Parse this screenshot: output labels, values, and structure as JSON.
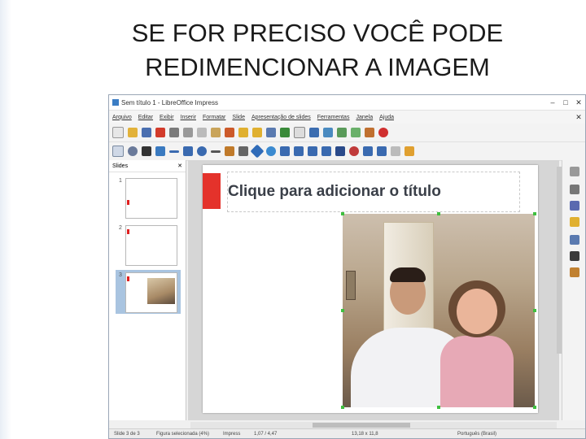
{
  "heading": {
    "line1": "SE FOR PRECISO VOCÊ PODE",
    "line2": "REDIMENCIONAR A IMAGEM"
  },
  "window": {
    "title": "Sem título 1 - LibreOffice Impress",
    "controls": {
      "minimize": "–",
      "maximize": "□",
      "close": "✕"
    }
  },
  "menu": {
    "items": [
      "Arquivo",
      "Editar",
      "Exibir",
      "Inserir",
      "Formatar",
      "Slide",
      "Apresentação de slides",
      "Ferramentas",
      "Janela",
      "Ajuda"
    ],
    "close": "✕"
  },
  "sidebar": {
    "title": "Slides",
    "close": "✕",
    "slides": [
      {
        "number": "1",
        "selected": false
      },
      {
        "number": "2",
        "selected": false
      },
      {
        "number": "3",
        "selected": true
      }
    ]
  },
  "slide": {
    "title_placeholder": "Clique para adicionar o título",
    "accent_color": "#e4322b"
  },
  "statusbar": {
    "slide": "Slide 3 de 3",
    "selection": "Figura selecionada (4%)",
    "layout": "Impress",
    "position": "1,07 / 4,47",
    "size": "13,18 x 11,8",
    "language": "Português (Brasil)"
  },
  "icons": {
    "toolbar1": [
      "new-icon",
      "open-icon",
      "save-icon",
      "export-pdf-icon",
      "print-icon",
      "cut-icon",
      "copy-icon",
      "paste-icon",
      "clone-format-icon",
      "undo-icon",
      "redo-icon",
      "find-icon",
      "spellcheck-icon",
      "grid-icon",
      "display-icon",
      "chart-icon",
      "table-icon",
      "image-icon",
      "gallery-icon",
      "help-icon"
    ],
    "toolbar2": [
      "select-icon",
      "zoom-icon",
      "text-icon",
      "fill-icon",
      "line-icon",
      "rectangle-icon",
      "ellipse-icon",
      "arrow-icon",
      "curve-icon",
      "connector-icon",
      "basic-shapes-icon",
      "symbol-shapes-icon",
      "block-arrows-icon",
      "flowchart-icon",
      "callouts-icon",
      "stars-icon",
      "3d-icon",
      "rotate-icon",
      "align-icon",
      "arrange-icon",
      "shadow-icon",
      "crop-icon"
    ],
    "rightbar": [
      "properties-icon",
      "styles-icon",
      "gallery-sidebar-icon",
      "navigator-icon",
      "animation-icon",
      "master-slides-icon",
      "functions-icon"
    ]
  }
}
